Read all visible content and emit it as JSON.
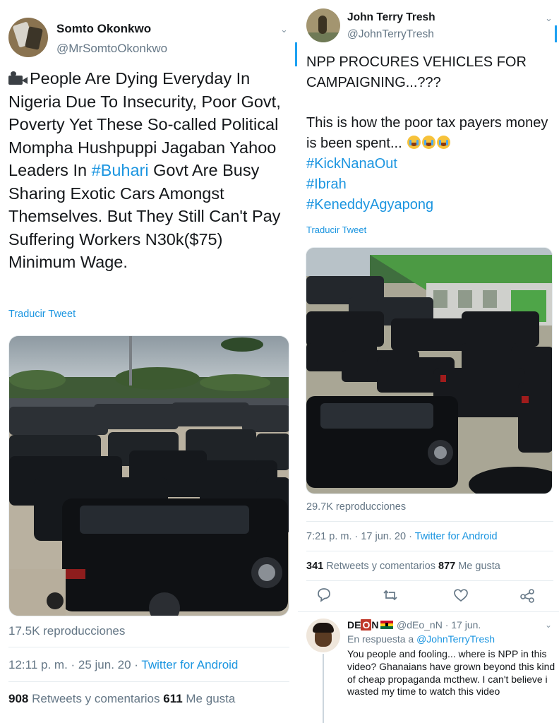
{
  "left_tweet": {
    "author_name": "Somto Okonkwo",
    "author_handle": "@MrSomtoOkonkwo",
    "text_before_hashtag": "People Are Dying Everyday In Nigeria Due To Insecurity, Poor Govt, Poverty Yet These So-called Political Mompha Hushpuppi Jagaban Yahoo Leaders In ",
    "hashtag": "#Buhari",
    "text_after_hashtag": " Govt Are Busy Sharing Exotic Cars Amongst Themselves. But They Still Can't Pay Suffering Workers N30k($75) Minimum Wage.",
    "leading_icon": "movie-camera-icon",
    "translate_label": "Traducir Tweet",
    "views": "17.5K reproducciones",
    "time": "12:11 p. m. · 25 jun. 20 · ",
    "source": "Twitter for Android",
    "retweets_count": "908",
    "retweets_label": " Retweets y comentarios ",
    "likes_count": "611",
    "likes_label": " Me gusta"
  },
  "right_tweet": {
    "author_name": "John Terry Tresh",
    "author_handle": "@JohnTerryTresh",
    "line1": "NPP PROCURES VEHICLES FOR CAMPAIGNING...???",
    "line2": "This is how the poor tax payers money is been spent... ",
    "emoji": "loudly-crying-face-icon",
    "hashtags": [
      "#KickNanaOut",
      "#Ibrah",
      "#KeneddyAgyapong"
    ],
    "translate_label": "Traducir Tweet",
    "views": "29.7K reproducciones",
    "time": "7:21 p. m. · 17 jun. 20 · ",
    "source": "Twitter for Android",
    "retweets_count": "341",
    "retweets_label": " Retweets y comentarios ",
    "likes_count": "877",
    "likes_label": " Me gusta"
  },
  "reply": {
    "name_prefix": "DE",
    "name_boxed": "O",
    "name_suffix": "N",
    "flag": "ghana-flag-icon",
    "handle": "@dEo_nN",
    "date": " · 17 jun.",
    "reply_prefix": "En respuesta a ",
    "reply_to": "@JohnTerryTresh",
    "text": "You people and fooling... where is NPP in this video? Ghanaians have grown beyond this kind of cheap propaganda mcthew. I can't believe i wasted my time to watch this video"
  },
  "colors": {
    "link": "#1b95e0",
    "muted": "#657786",
    "text": "#14171a"
  }
}
